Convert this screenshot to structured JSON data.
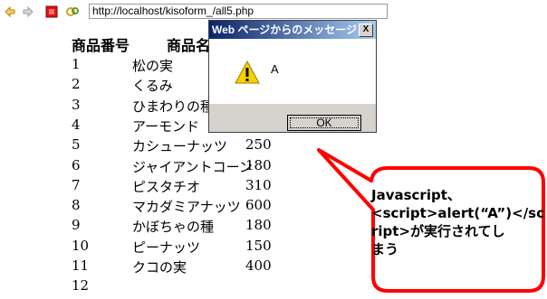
{
  "browser": {
    "address": "http://localhost/kisoform_/all5.php"
  },
  "table": {
    "headers": {
      "id": "商品番号",
      "name": "商品名"
    },
    "rows": [
      {
        "id": "1",
        "name": "松の実",
        "price": ""
      },
      {
        "id": "2",
        "name": "くるみ",
        "price": ""
      },
      {
        "id": "3",
        "name": "ひまわりの種",
        "price": ""
      },
      {
        "id": "4",
        "name": "アーモンド",
        "price": ""
      },
      {
        "id": "5",
        "name": "カシューナッツ",
        "price": "250"
      },
      {
        "id": "6",
        "name": "ジャイアントコーン",
        "price": "180"
      },
      {
        "id": "7",
        "name": "ピスタチオ",
        "price": "310"
      },
      {
        "id": "8",
        "name": "マカダミアナッツ",
        "price": "600"
      },
      {
        "id": "9",
        "name": "かぼちゃの種",
        "price": "180"
      },
      {
        "id": "10",
        "name": "ピーナッツ",
        "price": "150"
      },
      {
        "id": "11",
        "name": "クコの実",
        "price": "400"
      },
      {
        "id": "12",
        "name": "",
        "price": ""
      }
    ]
  },
  "dialog": {
    "title": "Web ページからのメッセージ",
    "close": "X",
    "message": "A",
    "ok_label": "OK"
  },
  "callout": {
    "lines": [
      "Javascript、",
      "<script>alert(“A”)</sc",
      "ript>が実行されてし",
      "まう"
    ]
  }
}
